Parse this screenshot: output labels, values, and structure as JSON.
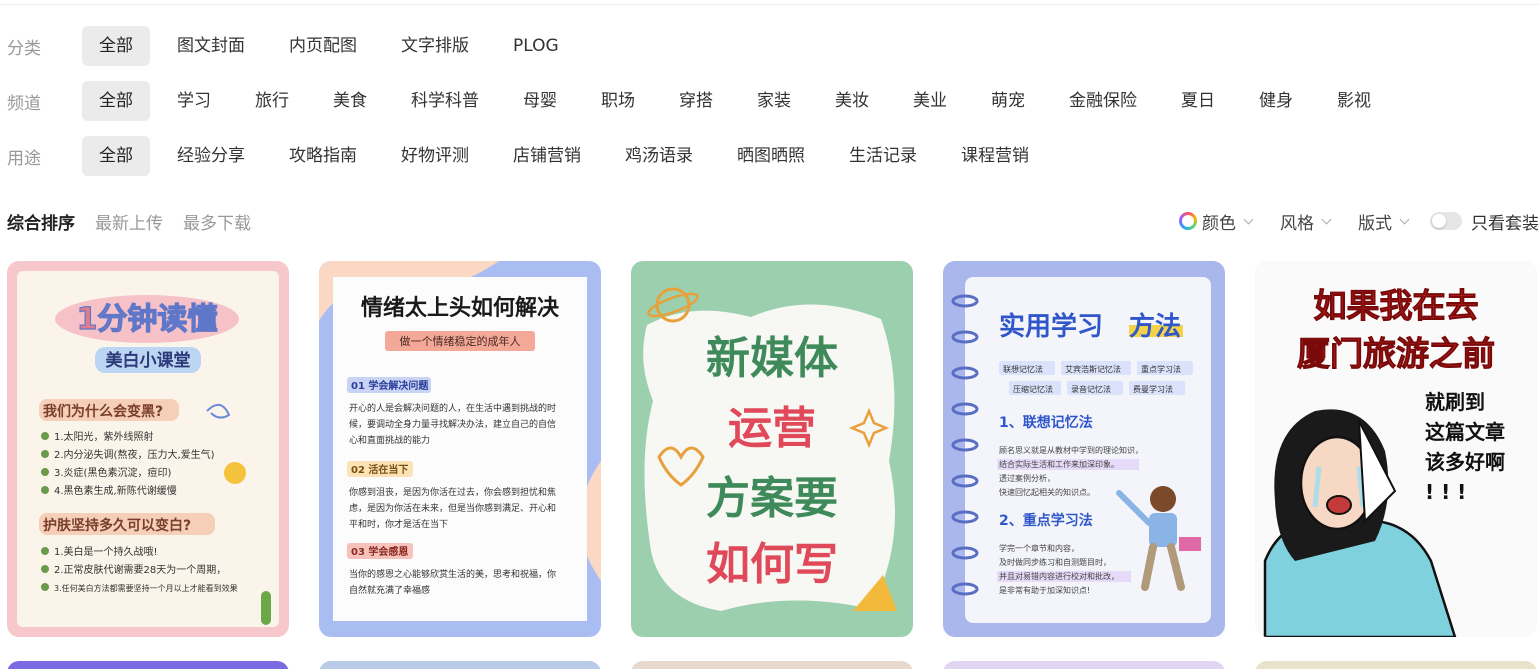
{
  "filters": {
    "category": {
      "label": "分类",
      "items": [
        "全部",
        "图文封面",
        "内页配图",
        "文字排版",
        "PLOG"
      ]
    },
    "channel": {
      "label": "频道",
      "items": [
        "全部",
        "学习",
        "旅行",
        "美食",
        "科学科普",
        "母婴",
        "职场",
        "穿搭",
        "家装",
        "美妆",
        "美业",
        "萌宠",
        "金融保险",
        "夏日",
        "健身",
        "影视"
      ]
    },
    "usage": {
      "label": "用途",
      "items": [
        "全部",
        "经验分享",
        "攻略指南",
        "好物评测",
        "店铺营销",
        "鸡汤语录",
        "晒图晒照",
        "生活记录",
        "课程营销"
      ]
    }
  },
  "sort": {
    "items": [
      "综合排序",
      "最新上传",
      "最多下载"
    ],
    "active": "综合排序"
  },
  "options": {
    "color_label": "颜色",
    "style_label": "风格",
    "layout_label": "版式",
    "toggle_label": "只看套装",
    "toggle_on": false
  },
  "cards": [
    {
      "title": "1分钟读懂",
      "subtitle": "美白小课堂",
      "q1": "我们为什么会变黑?",
      "q1_items": [
        "1.太阳光，紫外线照射",
        "2.内分泌失调(熬夜，压力大,爱生气)",
        "3.炎症(黑色素沉淀，痘印)",
        "4.黑色素生成,新陈代谢缓慢"
      ],
      "q2": "护肤坚持多久可以变白?",
      "q2_items": [
        "1.美白是一个持久战哦!",
        "2.正常皮肤代谢需要28天为一个周期，",
        "3.任何美白方法都需要坚持一个月以上才能看到效果"
      ]
    },
    {
      "title": "情绪太上头如何解决",
      "subtitle": "做一个情绪稳定的成年人",
      "sections": [
        {
          "heading": "01 学会解决问题",
          "text": [
            "开心的人是会解决问题的人，在生活中遇到挑战的时",
            "候，要调动全身力量寻找解决办法，建立自己的自信",
            "心和直面挑战的能力"
          ]
        },
        {
          "heading": "02 活在当下",
          "text": [
            "你感到沮丧，是因为你活在过去，你会感到担忧和焦",
            "虑，是因为你活在未来，但是当你感到满足、开心和",
            "平和时，你才是活在当下"
          ]
        },
        {
          "heading": "03 学会感恩",
          "text": [
            "当你的感恩之心能够欣赏生活的美，思考和祝福，你",
            "自然就充满了幸福感"
          ]
        }
      ]
    },
    {
      "lines": [
        "新媒体",
        "运营",
        "方案要",
        "如何写"
      ]
    },
    {
      "title_a": "实用学习",
      "title_b": "方法",
      "tags_row1": [
        "联想记忆法",
        "艾宾浩斯记忆法",
        "重点学习法"
      ],
      "tags_row2": [
        "压缩记忆法",
        "录音记忆法",
        "费曼学习法"
      ],
      "sec1": "1、联想记忆法",
      "sec1_text": [
        "顾名思义就是从教材中学到的理论知识，",
        "结合实际生活和工作来加深印象。",
        "透过案例分析，",
        "快速回忆起相关的知识点。"
      ],
      "sec2": "2、重点学习法",
      "sec2_text": [
        "学完一个章节和内容，",
        "及时做同步练习和自测题目时，",
        "并且对易错内容进行校对和批改，",
        "是非常有助于加深知识点!"
      ]
    },
    {
      "title1": "如果我在去",
      "title2": "厦门旅游之前",
      "side": [
        "就刷到",
        "这篇文章",
        "该多好啊",
        "! ! !"
      ]
    }
  ],
  "colors": {
    "chip_active_bg": "#ebebeb",
    "label_gray": "#999999"
  }
}
